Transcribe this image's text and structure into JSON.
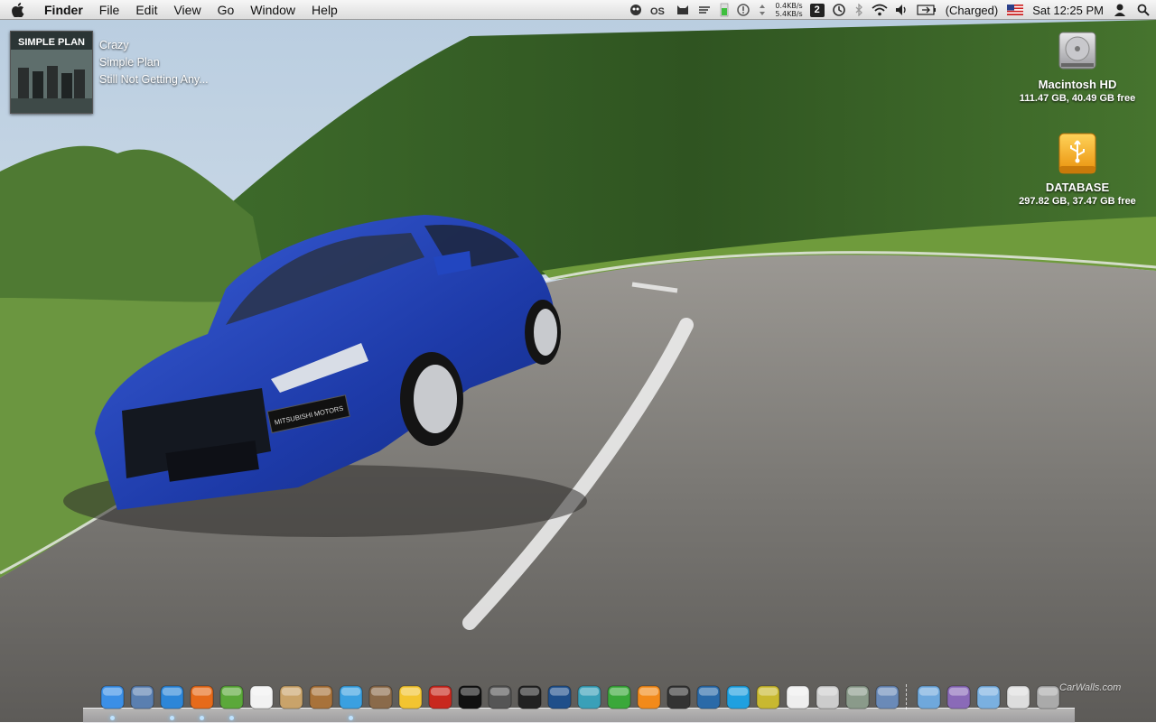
{
  "menubar": {
    "app_name": "Finder",
    "menus": [
      "File",
      "Edit",
      "View",
      "Go",
      "Window",
      "Help"
    ],
    "network": {
      "up": "0.4KB/s",
      "down": "5.4KB/s"
    },
    "spaces_number": "2",
    "battery_status": "(Charged)",
    "clock": "Sat 12:25 PM"
  },
  "now_playing": {
    "album_art_text": "SIMPLE PLAN",
    "track": "Crazy",
    "artist": "Simple Plan",
    "album": "Still Not Getting Any..."
  },
  "desktop": {
    "drives": [
      {
        "name": "Macintosh HD",
        "info": "111.47 GB, 40.49 GB free",
        "icon": "hard-drive-icon"
      },
      {
        "name": "DATABASE",
        "info": "297.82 GB, 37.47 GB free",
        "icon": "usb-drive-icon"
      }
    ],
    "wallpaper_plate_text": "MITSUBISHI MOTORS"
  },
  "dock": {
    "apps": [
      {
        "name": "finder",
        "color": "#3b8fe6"
      },
      {
        "name": "preview",
        "color": "#5a7fb0"
      },
      {
        "name": "safari",
        "color": "#2c86d8"
      },
      {
        "name": "firefox",
        "color": "#e66a1a"
      },
      {
        "name": "adium",
        "color": "#5ba83a"
      },
      {
        "name": "ical",
        "color": "#f2f2f2"
      },
      {
        "name": "address-book",
        "color": "#c9a36a"
      },
      {
        "name": "iphoto",
        "color": "#a8723a"
      },
      {
        "name": "itunes",
        "color": "#3aa0e0"
      },
      {
        "name": "photo-booth",
        "color": "#8a6a4a"
      },
      {
        "name": "cyberduck",
        "color": "#f2c431"
      },
      {
        "name": "flash",
        "color": "#c8281e"
      },
      {
        "name": "ableton-live",
        "color": "#111111"
      },
      {
        "name": "final-cut",
        "color": "#555555"
      },
      {
        "name": "aperture",
        "color": "#222222"
      },
      {
        "name": "photoshop",
        "color": "#1f4f8a"
      },
      {
        "name": "dreamweaver",
        "color": "#3aa0b8"
      },
      {
        "name": "utorrent",
        "color": "#3aa83a"
      },
      {
        "name": "vlc",
        "color": "#f28a1a"
      },
      {
        "name": "movie-app",
        "color": "#333333"
      },
      {
        "name": "voice-chat",
        "color": "#2a6aa8"
      },
      {
        "name": "skype",
        "color": "#1fa0e0"
      },
      {
        "name": "bbedit",
        "color": "#c8b830"
      },
      {
        "name": "textedit",
        "color": "#eeeeee"
      },
      {
        "name": "scanner",
        "color": "#cccccc"
      },
      {
        "name": "printer",
        "color": "#8a9a8a"
      },
      {
        "name": "iphoto-library",
        "color": "#6a8ab8"
      },
      {
        "name": "applications-folder",
        "color": "#6fa8dc"
      },
      {
        "name": "documents-stack",
        "color": "#8a6ab8"
      },
      {
        "name": "downloads-folder",
        "color": "#7ab0e0"
      },
      {
        "name": "keyboard",
        "color": "#dddddd"
      },
      {
        "name": "trash",
        "color": "#aaaaaa"
      }
    ],
    "watermark": "CarWalls.com"
  },
  "colors": {
    "sky": "#cfdde8",
    "trees": "#3f6a2a",
    "grass": "#5f8a32",
    "road": "#7d7b78",
    "car": "#1f3fb0"
  }
}
